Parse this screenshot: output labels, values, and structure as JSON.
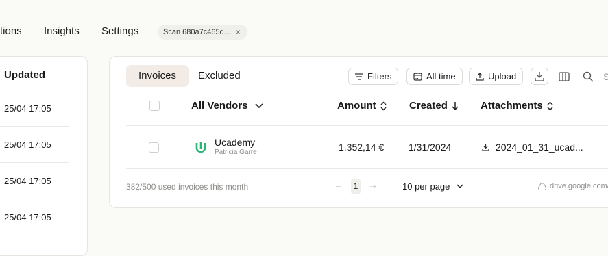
{
  "nav": {
    "items": [
      "tions",
      "Insights",
      "Settings"
    ],
    "scan_chip": {
      "label": "Scan 680a7c465d...",
      "close": "×"
    }
  },
  "left_panel": {
    "header": "Updated",
    "rows": [
      "25/04 17:05",
      "25/04 17:05",
      "25/04 17:05",
      "25/04 17:05"
    ]
  },
  "tabs": {
    "invoices": "Invoices",
    "excluded": "Excluded"
  },
  "toolbar": {
    "filters": "Filters",
    "all_time": "All time",
    "upload": "Upload",
    "search_partial": "S"
  },
  "table": {
    "headers": {
      "vendors": "All Vendors",
      "amount": "Amount",
      "created": "Created",
      "attachments": "Attachments"
    },
    "rows": [
      {
        "vendor": "Ucademy",
        "contact": "Patricia Garre",
        "amount": "1.352,14 €",
        "created": "1/31/2024",
        "attachment": "2024_01_31_ucad..."
      }
    ]
  },
  "footer": {
    "usage": "382/500 used invoices this month",
    "page": "1",
    "prev": "←",
    "next": "→",
    "per_page": "10 per page",
    "source": "drive.google.com/"
  },
  "colors": {
    "vendor_logo": "#2bb673",
    "active_tab_bg": "#f3ece6"
  }
}
